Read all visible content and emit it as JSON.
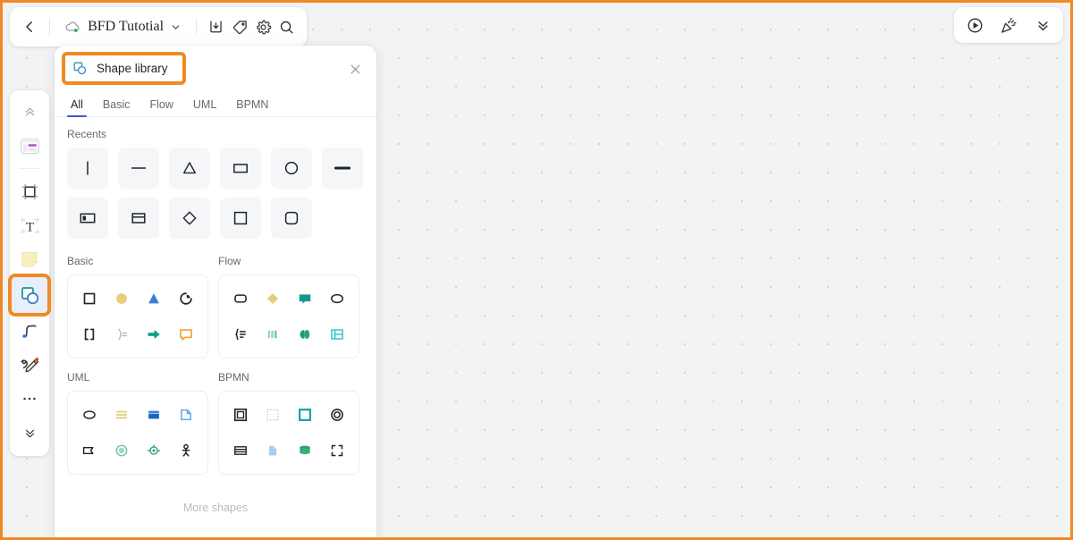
{
  "topbar": {
    "back_icon": "chevron-left-icon",
    "cloud_icon": "cloud-synced-icon",
    "doc_title": "BFD Tutotial",
    "doc_caret_icon": "chevron-down-icon",
    "actions": [
      {
        "name": "download-icon",
        "label": "Download"
      },
      {
        "name": "tag-icon",
        "label": "Tag"
      },
      {
        "name": "settings-gear-icon",
        "label": "Settings"
      },
      {
        "name": "search-icon",
        "label": "Search"
      }
    ]
  },
  "topright": {
    "actions": [
      {
        "name": "present-play-icon",
        "label": "Present"
      },
      {
        "name": "party-popper-icon",
        "label": "Celebrate"
      },
      {
        "name": "chevrons-down-icon",
        "label": "Collapse"
      }
    ]
  },
  "left_toolbar": {
    "items": [
      {
        "name": "chevrons-up-icon",
        "label": "Scroll up"
      },
      {
        "name": "template-icon",
        "label": "Templates"
      },
      {
        "name": "frame-icon",
        "label": "Frame"
      },
      {
        "name": "text-icon",
        "label": "Text"
      },
      {
        "name": "sticky-note-icon",
        "label": "Sticky note"
      },
      {
        "name": "shape-tool-icon",
        "label": "Shapes"
      },
      {
        "name": "connector-icon",
        "label": "Connector"
      },
      {
        "name": "pen-scribble-icon",
        "label": "Pen"
      },
      {
        "name": "more-ellipsis-icon",
        "label": "More"
      },
      {
        "name": "chevrons-down-icon",
        "label": "Scroll down"
      }
    ],
    "active_index": 5
  },
  "panel": {
    "icon": "shape-library-icon",
    "title": "Shape library",
    "close_icon": "close-icon",
    "tabs": [
      {
        "label": "All",
        "active": true
      },
      {
        "label": "Basic",
        "active": false
      },
      {
        "label": "Flow",
        "active": false
      },
      {
        "label": "UML",
        "active": false
      },
      {
        "label": "BPMN",
        "active": false
      }
    ],
    "recents": {
      "label": "Recents",
      "shapes": [
        "vertical-line-shape",
        "horizontal-line-shape",
        "triangle-shape",
        "rectangle-shape",
        "circle-shape",
        "thick-line-shape",
        "left-panel-shape",
        "top-header-shape",
        "diamond-shape",
        "square-shape",
        "rounded-square-shape"
      ]
    },
    "categories": [
      {
        "label": "Basic",
        "shapes": [
          "square-outline-shape",
          "filled-circle-shape",
          "filled-triangle-shape",
          "pie-arc-shape",
          "brackets-shape",
          "brace-equals-shape",
          "arrow-right-shape",
          "speech-bubble-shape"
        ]
      },
      {
        "label": "Flow",
        "shapes": [
          "rounded-rect-shape",
          "diamond-filled-shape",
          "callout-filled-shape",
          "ellipse-outline-shape",
          "brace-list-shape",
          "parallel-bars-shape",
          "split-oval-shape",
          "table-grid-shape"
        ]
      },
      {
        "label": "UML",
        "shapes": [
          "ellipse-use-case-shape",
          "stacked-lines-shape",
          "class-box-shape",
          "document-page-shape",
          "flag-tag-shape",
          "filled-state-circle-shape",
          "lifeline-port-shape",
          "actor-stickman-shape"
        ]
      },
      {
        "label": "BPMN",
        "shapes": [
          "nested-square-shape",
          "dotted-square-shape",
          "teal-square-shape",
          "double-circle-shape",
          "striped-rect-shape",
          "data-object-shape",
          "data-store-shape",
          "corner-brackets-shape"
        ]
      }
    ],
    "more_shapes_label": "More shapes"
  },
  "colors": {
    "accent_highlight": "#f08a24",
    "tab_underline": "#3b56d9",
    "teal": "#1e9e94",
    "green": "#2ea96f",
    "blue": "#3b7fd4",
    "light_blue": "#9dc8f0",
    "yellow": "#e5ce7e",
    "orange": "#f0a030",
    "dark": "#20242b",
    "purple": "#a855c8"
  }
}
